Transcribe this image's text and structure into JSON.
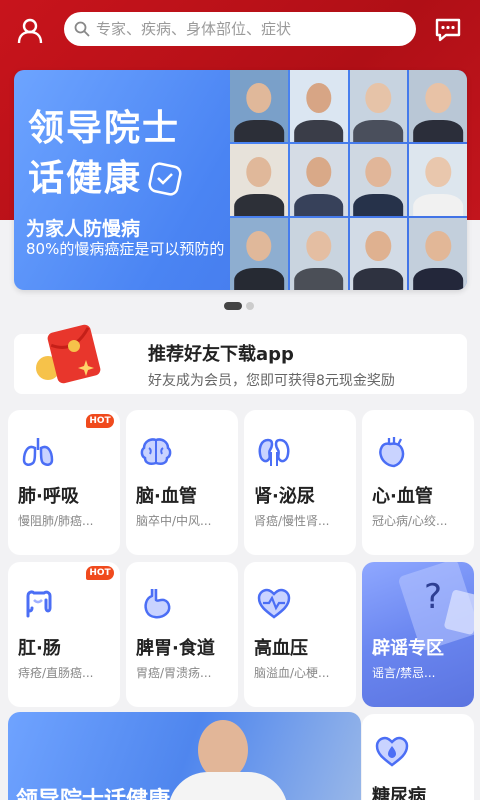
{
  "topbar": {
    "search_placeholder": "专家、疾病、身体部位、症状"
  },
  "banner": {
    "title_line1": "领导院士",
    "title_line2": "话健康",
    "subtitle": "为家人防慢病",
    "caption": "80%的慢病癌症是可以预防的",
    "active_slide": 1,
    "slide_count": 2
  },
  "recommend": {
    "title": "推荐好友下载app",
    "subtitle": "好友成为会员，您即可获得8元现金奖励"
  },
  "categories": [
    {
      "name": "肺·呼吸",
      "desc": "慢阻肺/肺癌...",
      "hot": "HOT",
      "icon": "lungs-icon"
    },
    {
      "name": "脑·血管",
      "desc": "脑卒中/中风...",
      "hot": "",
      "icon": "brain-icon"
    },
    {
      "name": "肾·泌尿",
      "desc": "肾癌/慢性肾...",
      "hot": "",
      "icon": "kidney-icon"
    },
    {
      "name": "心·血管",
      "desc": "冠心病/心绞...",
      "hot": "",
      "icon": "heart-organ-icon"
    },
    {
      "name": "肛·肠",
      "desc": "痔疮/直肠癌...",
      "hot": "HOT",
      "icon": "intestine-icon"
    },
    {
      "name": "脾胃·食道",
      "desc": "胃癌/胃溃疡...",
      "hot": "",
      "icon": "stomach-icon"
    },
    {
      "name": "高血压",
      "desc": "脑溢血/心梗...",
      "hot": "",
      "icon": "heart-pulse-icon"
    },
    {
      "name": "辟谣专区",
      "desc": "谣言/禁忌...",
      "hot": "",
      "icon": "question-icon"
    },
    {
      "name": "糖尿病",
      "desc": "",
      "hot": "",
      "icon": "diabetes-icon"
    }
  ],
  "promo": {
    "title": "领导院士话健康"
  },
  "colors": {
    "brand_red": "#c8141c",
    "icon_blue": "#4b6ef5",
    "hot_orange": "#f04a1d"
  }
}
